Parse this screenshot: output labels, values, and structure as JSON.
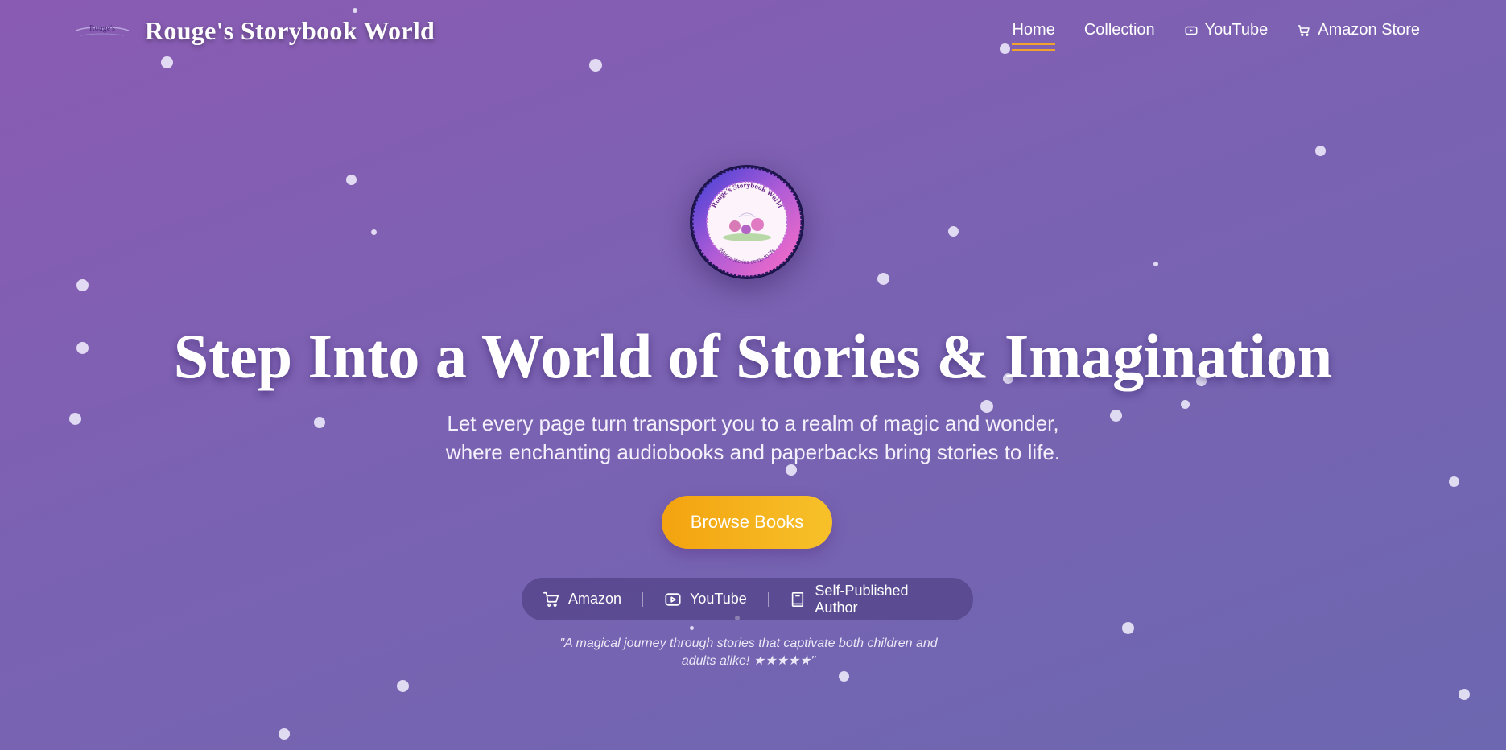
{
  "header": {
    "brand_title": "Rouge's Storybook World",
    "logo_text": "Rouge's"
  },
  "nav": [
    {
      "label": "Home",
      "icon": null,
      "active": true
    },
    {
      "label": "Collection",
      "icon": null,
      "active": false
    },
    {
      "label": "YouTube",
      "icon": "youtube-icon",
      "active": false
    },
    {
      "label": "Amazon Store",
      "icon": "cart-icon",
      "active": false
    }
  ],
  "hero": {
    "seal_text_top": "Rouge's Storybook World",
    "seal_text_bottom": "Where stories come to life",
    "headline": "Step Into a World of Stories & Imagination",
    "subtitle_line1": "Let every page turn transport you to a realm of magic and wonder,",
    "subtitle_line2": "where enchanting audiobooks and paperbacks bring stories to life.",
    "cta_label": "Browse Books",
    "badges": [
      {
        "label": "Amazon",
        "icon": "cart-icon"
      },
      {
        "label": "YouTube",
        "icon": "youtube-icon"
      },
      {
        "label": "Self-Published Author",
        "icon": "book-icon"
      }
    ],
    "quote_line1": "\"A magical journey through stories that captivate both children and",
    "quote_line2": "adults alike! ★★★★★\""
  },
  "colors": {
    "accent": "#f2a32c",
    "cta_start": "#f3a30f",
    "cta_end": "#f7c12a",
    "bg_top": "#8a5bb3",
    "bg_bottom": "#6c67b0"
  }
}
